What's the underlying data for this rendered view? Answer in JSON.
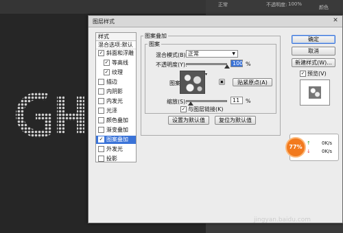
{
  "ps": {
    "top_mode": "正常",
    "top_opacity_label": "不透明度:",
    "top_opacity_value": "100%",
    "top_fill_label": "颜色",
    "watermark": "jingyan.baidu.com",
    "fx_percent": "77%",
    "fx_up": "0K/s",
    "fx_down": "0K/s"
  },
  "dialog": {
    "title": "图层样式",
    "close_icon": "close-icon",
    "styles_header": "样式",
    "blend_default": "混合选项:默认",
    "styles": [
      {
        "label": "斜面和浮雕",
        "checked": true,
        "indent": 0
      },
      {
        "label": "等高线",
        "checked": true,
        "indent": 1
      },
      {
        "label": "纹理",
        "checked": true,
        "indent": 1
      },
      {
        "label": "描边",
        "checked": false,
        "indent": 0
      },
      {
        "label": "内阴影",
        "checked": false,
        "indent": 0
      },
      {
        "label": "内发光",
        "checked": false,
        "indent": 0
      },
      {
        "label": "光泽",
        "checked": false,
        "indent": 0
      },
      {
        "label": "颜色叠加",
        "checked": false,
        "indent": 0
      },
      {
        "label": "渐变叠加",
        "checked": false,
        "indent": 0
      },
      {
        "label": "图案叠加",
        "checked": true,
        "indent": 0,
        "selected": true
      },
      {
        "label": "外发光",
        "checked": false,
        "indent": 0
      },
      {
        "label": "投影",
        "checked": false,
        "indent": 0
      }
    ],
    "section_title": "图案叠加",
    "subsection_title": "图案",
    "blend_mode_label": "混合模式(B):",
    "blend_mode_value": "正常",
    "opacity_label": "不透明度(Y):",
    "opacity_value": "100",
    "opacity_unit": "%",
    "pattern_label": "图案:",
    "snap_origin_button": "贴紧原点(A)",
    "scale_label": "缩放(S):",
    "scale_value": "11",
    "scale_unit": "%",
    "scale_level": 0.11,
    "opacity_level": 1.0,
    "link_label": "与图层链接(K)",
    "link_checked": true,
    "set_default_button": "设置为默认值",
    "reset_default_button": "复位为默认值",
    "ok_button": "确定",
    "cancel_button": "取消",
    "new_style_button": "新建样式(W)...",
    "preview_label": "预览(V)",
    "preview_checked": true
  }
}
